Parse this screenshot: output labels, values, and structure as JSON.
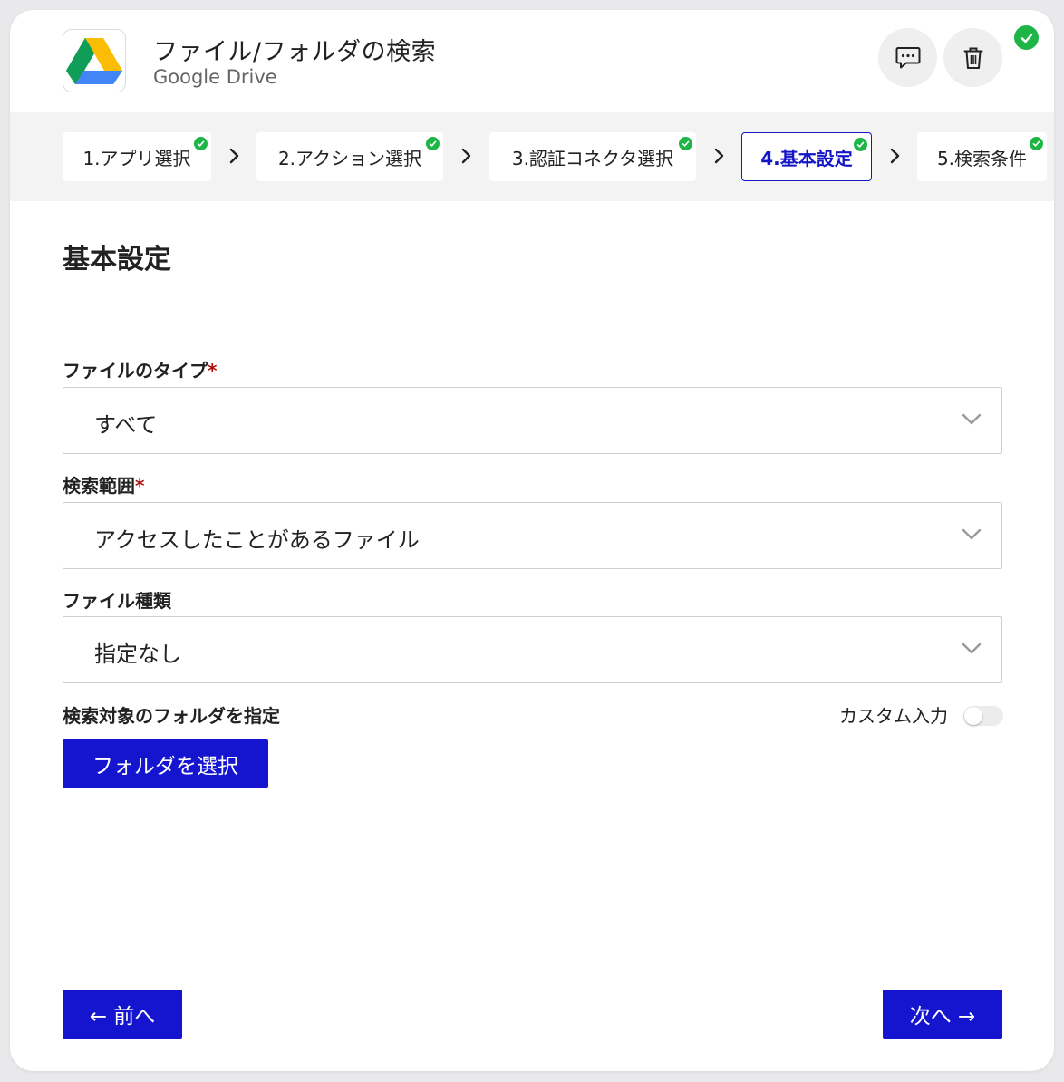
{
  "header": {
    "title": "ファイル/フォルダの検索",
    "subtitle": "Google Drive",
    "app_icon": "google-drive-logo",
    "comment_icon": "comment-icon",
    "trash_icon": "trash-icon",
    "status": "completed"
  },
  "steps": [
    {
      "label": "1.アプリ選択",
      "done": true
    },
    {
      "label": "2.アクション選択",
      "done": true
    },
    {
      "label": "3.認証コネクタ選択",
      "done": true
    },
    {
      "label": "4.基本設定",
      "done": true,
      "active": true
    },
    {
      "label": "5.検索条件",
      "done": true
    }
  ],
  "main": {
    "section_title": "基本設定",
    "fields": {
      "file_type": {
        "label": "ファイルのタイプ",
        "required_mark": "*",
        "value": "すべて"
      },
      "search_scope": {
        "label": "検索範囲",
        "required_mark": "*",
        "value": "アクセスしたことがあるファイル"
      },
      "file_kind": {
        "label": "ファイル種類",
        "value": "指定なし"
      },
      "target_folder": {
        "label": "検索対象のフォルダを指定",
        "custom_input_label": "カスタム入力",
        "button_label": "フォルダを選択"
      }
    }
  },
  "footer": {
    "prev_label": "← 前へ",
    "next_label": "次へ →"
  },
  "colors": {
    "accent": "#1515d0",
    "success": "#1eb547",
    "required": "#b01010"
  }
}
